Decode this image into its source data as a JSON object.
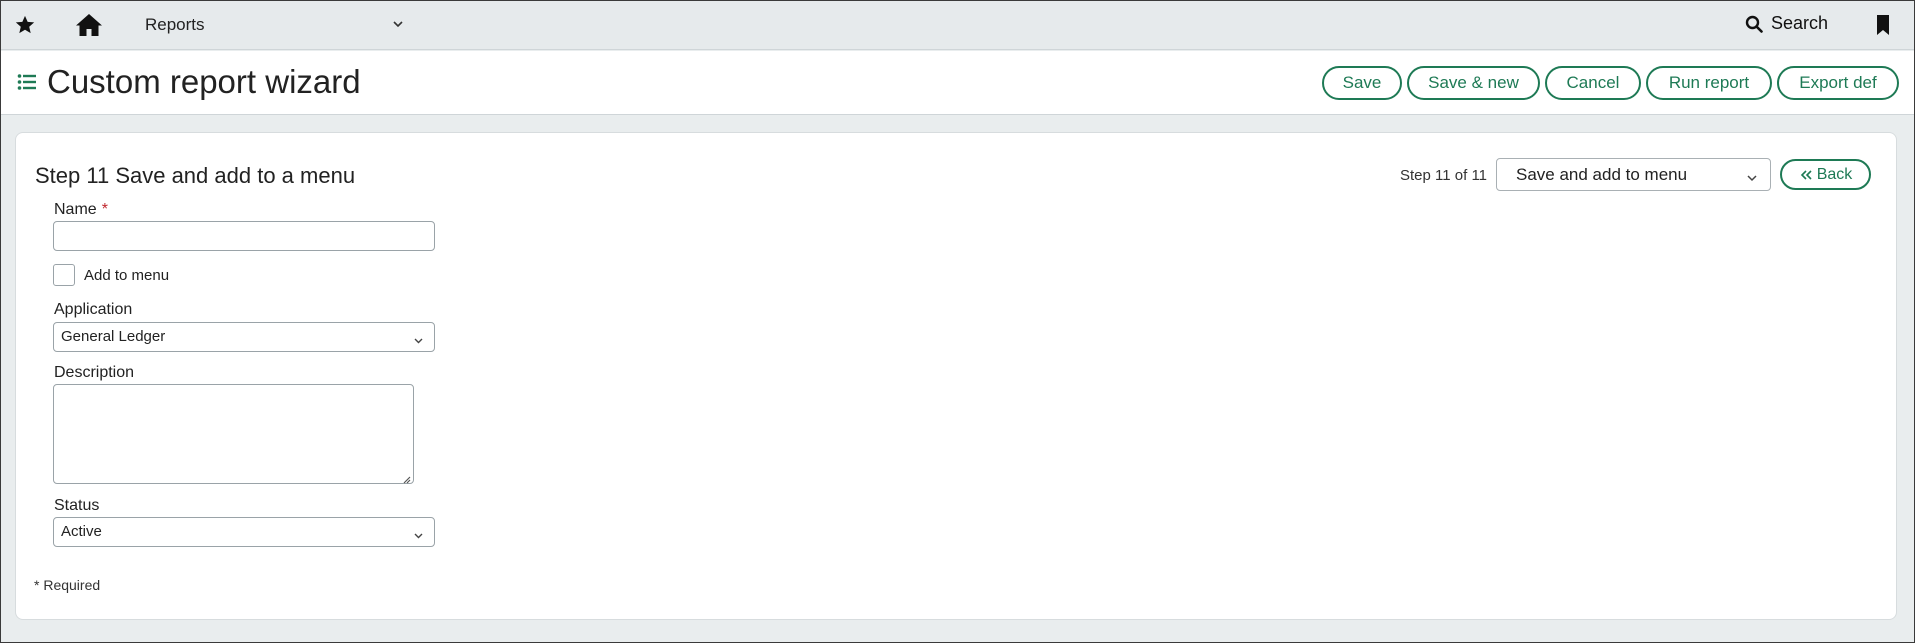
{
  "topbar": {
    "star_icon": "star-icon",
    "home_icon": "home-icon",
    "module_label": "Reports",
    "search_label": "Search",
    "bookmark_icon": "bookmark-icon"
  },
  "titlebar": {
    "list_icon": "list-icon",
    "title": "Custom report wizard",
    "buttons": {
      "save": "Save",
      "save_new": "Save & new",
      "cancel": "Cancel",
      "run_report": "Run report",
      "export_def": "Export def"
    }
  },
  "wizard": {
    "step_title": "Step 11 Save and add to a menu",
    "step_count": "Step 11 of 11",
    "step_select_value": "Save and add to menu",
    "back_label": "Back"
  },
  "form": {
    "name_label": "Name",
    "name_required_marker": "*",
    "name_value": "",
    "add_to_menu_label": "Add to menu",
    "add_to_menu_checked": false,
    "application_label": "Application",
    "application_value": "General Ledger",
    "description_label": "Description",
    "description_value": "",
    "status_label": "Status",
    "status_value": "Active",
    "required_note": "* Required"
  },
  "colors": {
    "accent": "#1e7a55",
    "required": "#c0262d",
    "topbar_bg": "#e6eaec"
  }
}
